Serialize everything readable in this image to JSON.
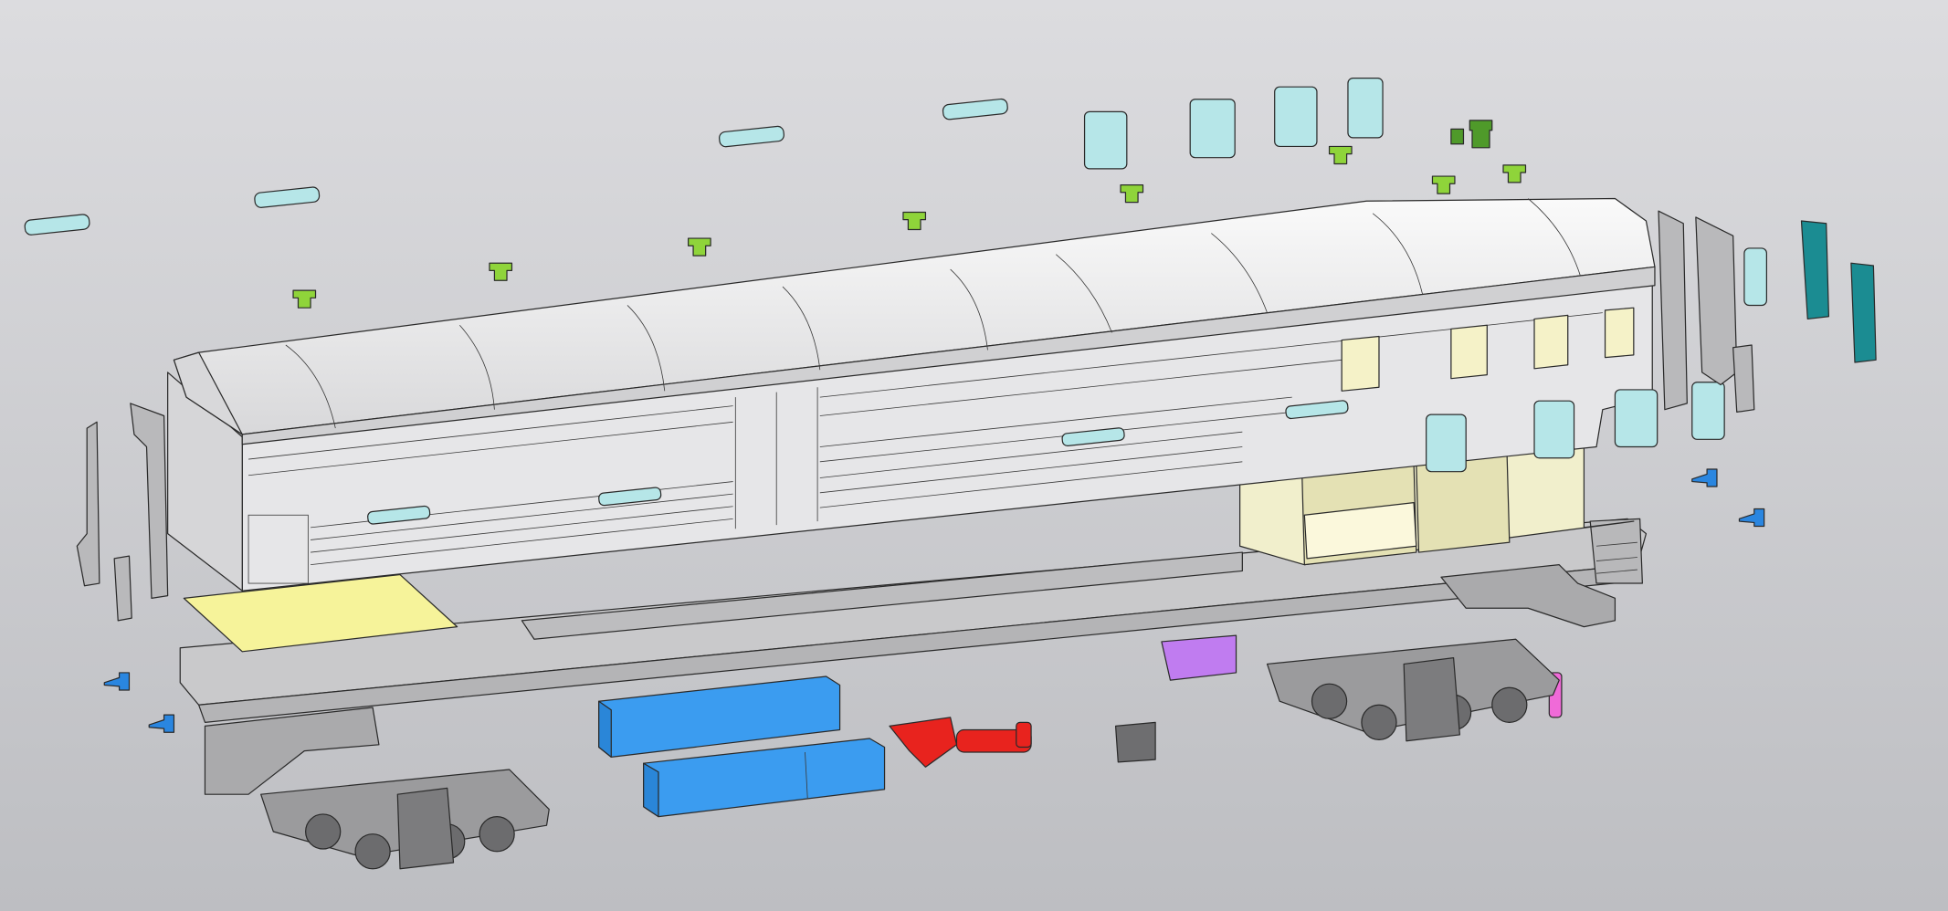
{
  "view": {
    "kind": "exploded-3d-cad-assembly",
    "colors": {
      "background_top": "#dcdcdf",
      "background_bottom": "#bdbec2",
      "body": "#e6e6e8",
      "roof": "#f2f2f3",
      "underframe": "#c9c9cb",
      "glass": "#b6e6e8",
      "green_caps": "#8fd43a",
      "floor_panel": "#f6f39a",
      "interior": "#f1efcc",
      "battery_boxes": "#3b9cf0",
      "brake_unit": "#e8231e",
      "purple_part": "#c07cf0",
      "pink_part": "#f06ad8",
      "teal_parts": "#1b8c92",
      "blue_fasteners": "#2a86e0",
      "bogie": "#9b9b9d"
    }
  }
}
